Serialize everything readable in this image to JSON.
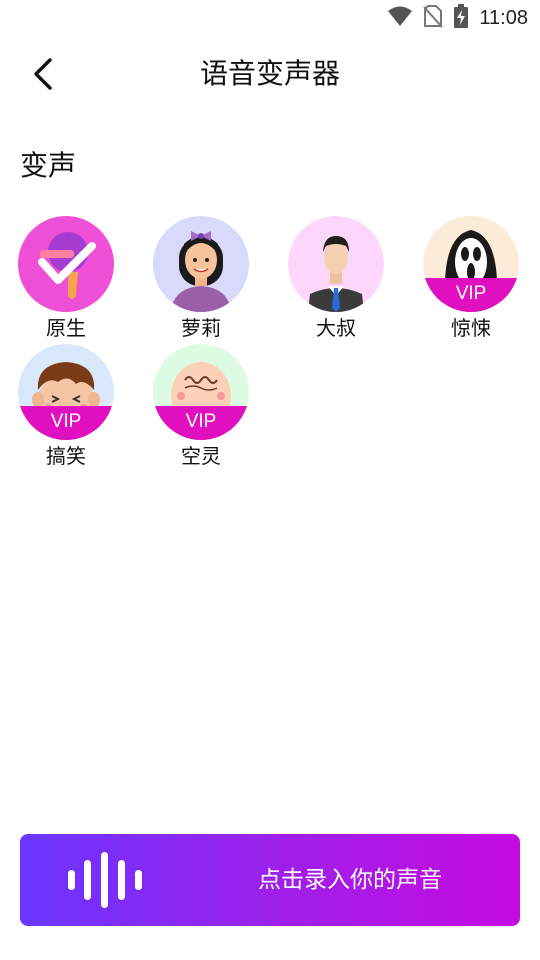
{
  "status_bar": {
    "time": "11:08",
    "icons": [
      "wifi-icon",
      "no-sim-icon",
      "battery-charging-icon"
    ]
  },
  "header": {
    "back_icon": "chevron-left-icon",
    "title": "语音变声器"
  },
  "section": {
    "title": "变声"
  },
  "effects": [
    {
      "label": "原生",
      "icon": "checkmark-microphone-icon",
      "selected": true,
      "vip": false
    },
    {
      "label": "萝莉",
      "icon": "girl-avatar-icon",
      "vip": false
    },
    {
      "label": "大叔",
      "icon": "man-in-suit-avatar-icon",
      "vip": false
    },
    {
      "label": "惊悚",
      "icon": "ghost-scream-mask-icon",
      "vip": true,
      "vip_label": "VIP"
    },
    {
      "label": "搞笑",
      "icon": "laughing-boy-avatar-icon",
      "vip": true,
      "vip_label": "VIP"
    },
    {
      "label": "空灵",
      "icon": "bald-baby-avatar-icon",
      "vip": true,
      "vip_label": "VIP"
    }
  ],
  "record_button": {
    "icon": "sound-wave-icon",
    "label": "点击录入你的声音"
  },
  "colors": {
    "accent_start": "#6a36ff",
    "accent_end": "#c50be0",
    "vip_band": "#e010c0",
    "selected_circle": "#ef4fd6"
  }
}
